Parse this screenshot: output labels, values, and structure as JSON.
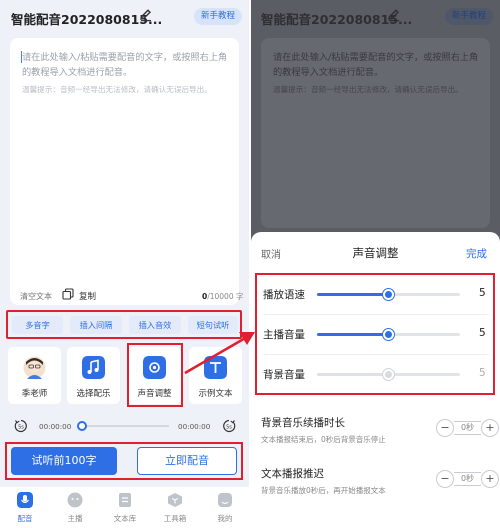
{
  "left": {
    "title": "智能配音2022080815...",
    "tutorial_label": "新手教程",
    "editor": {
      "placeholder": "请在此处输入/粘贴需要配音的文字，或按照右上角的教程导入文档进行配音。",
      "hint": "温馨提示：音频一经导出无法修改，请确认无误后导出。"
    },
    "clear_label": "清空文本",
    "copy_label": "复制",
    "char_count": "0",
    "char_total": "/10000 字",
    "chips": [
      "多音字",
      "插入间隔",
      "插入音效",
      "短句试听"
    ],
    "tools": [
      {
        "label": "季老师",
        "icon": "avatar-icon"
      },
      {
        "label": "选择配乐",
        "icon": "music-note-icon"
      },
      {
        "label": "声音调整",
        "icon": "sound-adjust-icon"
      },
      {
        "label": "示例文本",
        "icon": "text-sample-icon"
      }
    ],
    "player": {
      "current": "00:00:00",
      "total": "00:00:00",
      "back_label": "5s",
      "forward_label": "5s",
      "progress": 0
    },
    "try_button": "试听前100字",
    "dub_button": "立即配音",
    "tabs": [
      {
        "label": "配音",
        "active": true
      },
      {
        "label": "主播",
        "active": false
      },
      {
        "label": "文本库",
        "active": false
      },
      {
        "label": "工具箱",
        "active": false
      },
      {
        "label": "我的",
        "active": false
      }
    ]
  },
  "right": {
    "title": "智能配音2022080815...",
    "tutorial_label": "新手教程",
    "editor_placeholder": "请在此处输入/粘贴需要配音的文字，或按照右上角的教程导入文档进行配音。",
    "editor_hint": "温馨提示：音频一经导出无法修改，请确认无误后导出。",
    "sheet": {
      "cancel": "取消",
      "title": "声音调整",
      "done": "完成",
      "sliders": [
        {
          "label": "播放语速",
          "value": "5",
          "level": 0.5,
          "enabled": true
        },
        {
          "label": "主播音量",
          "value": "5",
          "level": 0.5,
          "enabled": true
        },
        {
          "label": "背景音量",
          "value": "5",
          "level": 0.5,
          "enabled": false
        }
      ],
      "options": [
        {
          "title": "背景音乐续播时长",
          "desc": "文本播报结束后，0秒后背景音乐停止",
          "value": "0秒"
        },
        {
          "title": "文本播报推迟",
          "desc": "背景音乐播放0秒后，再开始播报文本",
          "value": "0秒"
        }
      ]
    }
  },
  "colors": {
    "accent": "#2f6fe6",
    "highlight": "#e0202f"
  }
}
